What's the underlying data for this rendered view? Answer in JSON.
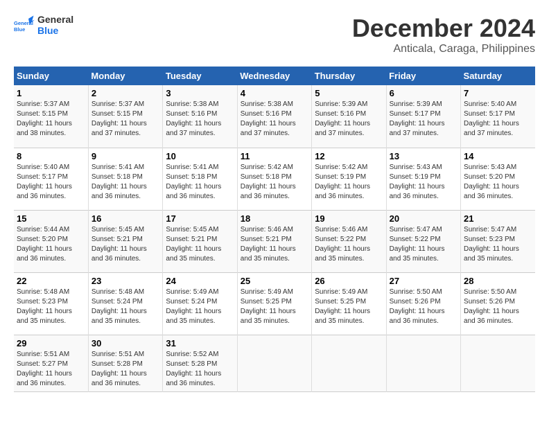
{
  "header": {
    "logo_line1": "General",
    "logo_line2": "Blue",
    "month": "December 2024",
    "location": "Anticala, Caraga, Philippines"
  },
  "days_of_week": [
    "Sunday",
    "Monday",
    "Tuesday",
    "Wednesday",
    "Thursday",
    "Friday",
    "Saturday"
  ],
  "weeks": [
    [
      {
        "num": "1",
        "info": "Sunrise: 5:37 AM\nSunset: 5:15 PM\nDaylight: 11 hours\nand 38 minutes."
      },
      {
        "num": "2",
        "info": "Sunrise: 5:37 AM\nSunset: 5:15 PM\nDaylight: 11 hours\nand 37 minutes."
      },
      {
        "num": "3",
        "info": "Sunrise: 5:38 AM\nSunset: 5:16 PM\nDaylight: 11 hours\nand 37 minutes."
      },
      {
        "num": "4",
        "info": "Sunrise: 5:38 AM\nSunset: 5:16 PM\nDaylight: 11 hours\nand 37 minutes."
      },
      {
        "num": "5",
        "info": "Sunrise: 5:39 AM\nSunset: 5:16 PM\nDaylight: 11 hours\nand 37 minutes."
      },
      {
        "num": "6",
        "info": "Sunrise: 5:39 AM\nSunset: 5:17 PM\nDaylight: 11 hours\nand 37 minutes."
      },
      {
        "num": "7",
        "info": "Sunrise: 5:40 AM\nSunset: 5:17 PM\nDaylight: 11 hours\nand 37 minutes."
      }
    ],
    [
      {
        "num": "8",
        "info": "Sunrise: 5:40 AM\nSunset: 5:17 PM\nDaylight: 11 hours\nand 36 minutes."
      },
      {
        "num": "9",
        "info": "Sunrise: 5:41 AM\nSunset: 5:18 PM\nDaylight: 11 hours\nand 36 minutes."
      },
      {
        "num": "10",
        "info": "Sunrise: 5:41 AM\nSunset: 5:18 PM\nDaylight: 11 hours\nand 36 minutes."
      },
      {
        "num": "11",
        "info": "Sunrise: 5:42 AM\nSunset: 5:18 PM\nDaylight: 11 hours\nand 36 minutes."
      },
      {
        "num": "12",
        "info": "Sunrise: 5:42 AM\nSunset: 5:19 PM\nDaylight: 11 hours\nand 36 minutes."
      },
      {
        "num": "13",
        "info": "Sunrise: 5:43 AM\nSunset: 5:19 PM\nDaylight: 11 hours\nand 36 minutes."
      },
      {
        "num": "14",
        "info": "Sunrise: 5:43 AM\nSunset: 5:20 PM\nDaylight: 11 hours\nand 36 minutes."
      }
    ],
    [
      {
        "num": "15",
        "info": "Sunrise: 5:44 AM\nSunset: 5:20 PM\nDaylight: 11 hours\nand 36 minutes."
      },
      {
        "num": "16",
        "info": "Sunrise: 5:45 AM\nSunset: 5:21 PM\nDaylight: 11 hours\nand 36 minutes."
      },
      {
        "num": "17",
        "info": "Sunrise: 5:45 AM\nSunset: 5:21 PM\nDaylight: 11 hours\nand 35 minutes."
      },
      {
        "num": "18",
        "info": "Sunrise: 5:46 AM\nSunset: 5:21 PM\nDaylight: 11 hours\nand 35 minutes."
      },
      {
        "num": "19",
        "info": "Sunrise: 5:46 AM\nSunset: 5:22 PM\nDaylight: 11 hours\nand 35 minutes."
      },
      {
        "num": "20",
        "info": "Sunrise: 5:47 AM\nSunset: 5:22 PM\nDaylight: 11 hours\nand 35 minutes."
      },
      {
        "num": "21",
        "info": "Sunrise: 5:47 AM\nSunset: 5:23 PM\nDaylight: 11 hours\nand 35 minutes."
      }
    ],
    [
      {
        "num": "22",
        "info": "Sunrise: 5:48 AM\nSunset: 5:23 PM\nDaylight: 11 hours\nand 35 minutes."
      },
      {
        "num": "23",
        "info": "Sunrise: 5:48 AM\nSunset: 5:24 PM\nDaylight: 11 hours\nand 35 minutes."
      },
      {
        "num": "24",
        "info": "Sunrise: 5:49 AM\nSunset: 5:24 PM\nDaylight: 11 hours\nand 35 minutes."
      },
      {
        "num": "25",
        "info": "Sunrise: 5:49 AM\nSunset: 5:25 PM\nDaylight: 11 hours\nand 35 minutes."
      },
      {
        "num": "26",
        "info": "Sunrise: 5:49 AM\nSunset: 5:25 PM\nDaylight: 11 hours\nand 35 minutes."
      },
      {
        "num": "27",
        "info": "Sunrise: 5:50 AM\nSunset: 5:26 PM\nDaylight: 11 hours\nand 36 minutes."
      },
      {
        "num": "28",
        "info": "Sunrise: 5:50 AM\nSunset: 5:26 PM\nDaylight: 11 hours\nand 36 minutes."
      }
    ],
    [
      {
        "num": "29",
        "info": "Sunrise: 5:51 AM\nSunset: 5:27 PM\nDaylight: 11 hours\nand 36 minutes."
      },
      {
        "num": "30",
        "info": "Sunrise: 5:51 AM\nSunset: 5:28 PM\nDaylight: 11 hours\nand 36 minutes."
      },
      {
        "num": "31",
        "info": "Sunrise: 5:52 AM\nSunset: 5:28 PM\nDaylight: 11 hours\nand 36 minutes."
      },
      {
        "num": "",
        "info": ""
      },
      {
        "num": "",
        "info": ""
      },
      {
        "num": "",
        "info": ""
      },
      {
        "num": "",
        "info": ""
      }
    ]
  ]
}
